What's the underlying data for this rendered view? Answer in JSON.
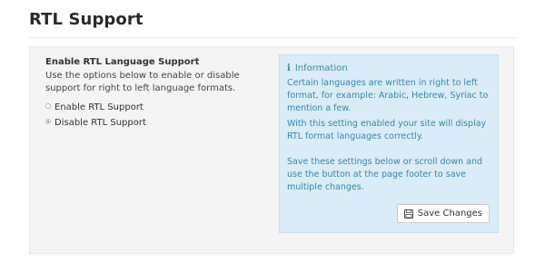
{
  "page": {
    "title": "RTL Support"
  },
  "setting": {
    "heading": "Enable RTL Language Support",
    "description": "Use the options below to enable or disable support for right to left language formats.",
    "options": [
      {
        "label": "Enable RTL Support",
        "checked": false
      },
      {
        "label": "Disable RTL Support",
        "checked": true
      }
    ]
  },
  "info": {
    "icon": "info-icon",
    "title": "Information",
    "paragraph1": "Certain languages are written in right to left format, for example: Arabic, Hebrew, Syriac to mention a few.",
    "paragraph2": "With this setting enabled your site will display RTL format languages correctly.",
    "paragraph3": "Save these settings below or scroll down and use the button at the page footer to save multiple changes.",
    "save_button_label": "Save Changes",
    "save_button_icon": "floppy-disk-icon"
  },
  "colors": {
    "info_background": "#d9ecf7",
    "info_text": "#3a87ad",
    "panel_background": "#f4f4f4"
  }
}
